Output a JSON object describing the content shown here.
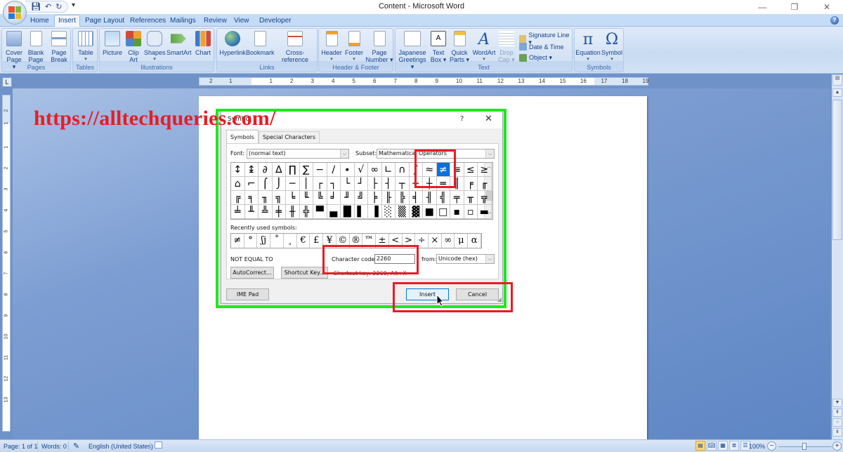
{
  "window": {
    "title": "Content - Microsoft Word",
    "controls": [
      "minimize",
      "restore",
      "close"
    ]
  },
  "quick_access": {
    "save": "save-icon",
    "undo": "undo-icon",
    "redo": "redo-icon",
    "customize": "▾"
  },
  "tabs": [
    {
      "label": "Home",
      "active": false
    },
    {
      "label": "Insert",
      "active": true
    },
    {
      "label": "Page Layout",
      "active": false
    },
    {
      "label": "References",
      "active": false
    },
    {
      "label": "Mailings",
      "active": false
    },
    {
      "label": "Review",
      "active": false
    },
    {
      "label": "View",
      "active": false
    },
    {
      "label": "Developer",
      "active": false
    }
  ],
  "ribbon": {
    "groups": {
      "pages": {
        "label": "Pages",
        "buttons": [
          {
            "line1": "Cover",
            "line2": "Page ▾"
          },
          {
            "line1": "Blank",
            "line2": "Page"
          },
          {
            "line1": "Page",
            "line2": "Break"
          }
        ]
      },
      "tables": {
        "label": "Tables",
        "buttons": [
          {
            "line1": "Table",
            "line2": "▾"
          }
        ]
      },
      "illustrations": {
        "label": "Illustrations",
        "buttons": [
          {
            "line1": "Picture",
            "line2": ""
          },
          {
            "line1": "Clip",
            "line2": "Art"
          },
          {
            "line1": "Shapes",
            "line2": "▾"
          },
          {
            "line1": "SmartArt",
            "line2": ""
          },
          {
            "line1": "Chart",
            "line2": ""
          }
        ]
      },
      "links": {
        "label": "Links",
        "buttons": [
          {
            "line1": "Hyperlink",
            "line2": ""
          },
          {
            "line1": "Bookmark",
            "line2": ""
          },
          {
            "line1": "Cross-reference",
            "line2": ""
          }
        ]
      },
      "header_footer": {
        "label": "Header & Footer",
        "buttons": [
          {
            "line1": "Header",
            "line2": "▾"
          },
          {
            "line1": "Footer",
            "line2": "▾"
          },
          {
            "line1": "Page",
            "line2": "Number ▾"
          }
        ]
      },
      "text": {
        "label": "Text",
        "buttons": [
          {
            "line1": "Japanese",
            "line2": "Greetings ▾"
          },
          {
            "line1": "Text",
            "line2": "Box ▾"
          },
          {
            "line1": "Quick",
            "line2": "Parts ▾"
          },
          {
            "line1": "WordArt",
            "line2": "▾"
          },
          {
            "line1": "Drop",
            "line2": "Cap ▾"
          }
        ],
        "small": [
          "Signature Line ▾",
          "Date & Time",
          "Object ▾"
        ]
      },
      "symbols": {
        "label": "Symbols",
        "buttons": [
          {
            "glyph": "π",
            "line1": "Equation",
            "line2": "▾"
          },
          {
            "glyph": "Ω",
            "line1": "Symbol",
            "line2": "▾"
          }
        ]
      }
    }
  },
  "ruler": {
    "h_ticks": [
      "2",
      "1",
      "1",
      "2",
      "3",
      "4",
      "5",
      "6",
      "7",
      "8",
      "9",
      "10",
      "11",
      "12",
      "13",
      "14",
      "15",
      "16",
      "17",
      "18",
      "19"
    ],
    "v_ticks": [
      "2",
      "1",
      "1",
      "2",
      "3",
      "4",
      "5",
      "6",
      "7",
      "8",
      "9",
      "10",
      "11",
      "12",
      "13"
    ],
    "corner": "L"
  },
  "watermark": "https://alltechqueries.com/",
  "dialog": {
    "title": "Symbol",
    "help": "?",
    "close": "✕",
    "tabs": [
      {
        "label": "Symbols",
        "active": true
      },
      {
        "label": "Special Characters",
        "active": false
      }
    ],
    "font_label": "Font:",
    "font_value": "(normal text)",
    "subset_label": "Subset:",
    "subset_value": "Mathematical Operators",
    "symbols": [
      [
        "↕",
        "↨",
        "∂",
        "∆",
        "∏",
        "∑",
        "−",
        "∕",
        "∙",
        "√",
        "∞",
        "∟",
        "∩",
        "∫",
        "≈",
        "≠",
        "≡",
        "≤",
        "≥"
      ],
      [
        "⌂",
        "⌐",
        "⌠",
        "⌡",
        "─",
        "│",
        "┌",
        "┐",
        "└",
        "┘",
        "├",
        "┤",
        "┬",
        "┴",
        "┼",
        "═",
        "║",
        "╒",
        "╓"
      ],
      [
        "╔",
        "╕",
        "╖",
        "╗",
        "╘",
        "╙",
        "╚",
        "╛",
        "╜",
        "╝",
        "╞",
        "╟",
        "╠",
        "╡",
        "╢",
        "╣",
        "╤",
        "╥",
        "╦"
      ],
      [
        "╧",
        "╨",
        "╩",
        "╪",
        "╫",
        "╬",
        "▀",
        "▄",
        "█",
        "▌",
        "▐",
        "░",
        "▒",
        "▓",
        "■",
        "□",
        "▪",
        "▫",
        "▬"
      ]
    ],
    "selected_symbol": "≠",
    "recent_label": "Recently used symbols:",
    "recent": [
      "≠",
      "°",
      "ʃj",
      "˚",
      "¸",
      "€",
      "£",
      "¥",
      "©",
      "®",
      "™",
      "±",
      "<",
      ">",
      "÷",
      "×",
      "∞",
      "μ",
      "α"
    ],
    "char_name": "NOT EQUAL TO",
    "char_code_label": "Character code:",
    "char_code_value": "2260",
    "from_label": "from:",
    "from_value": "Unicode (hex)",
    "shortcut_text": "Shortcut key: 2260, Alt+X",
    "autocorrect_label": "AutoCorrect...",
    "shortcut_key_label": "Shortcut Key...",
    "ime_pad_label": "IME Pad",
    "insert_label": "Insert",
    "cancel_label": "Cancel"
  },
  "status": {
    "page": "Page: 1 of 1",
    "words": "Words: 0",
    "language": "English (United States)",
    "zoom": "100%",
    "zoom_minus": "−",
    "zoom_plus": "+"
  },
  "colors": {
    "annotation_green": "#1fe81f",
    "annotation_red": "#e81c24",
    "selection_blue": "#0b6fdc"
  }
}
